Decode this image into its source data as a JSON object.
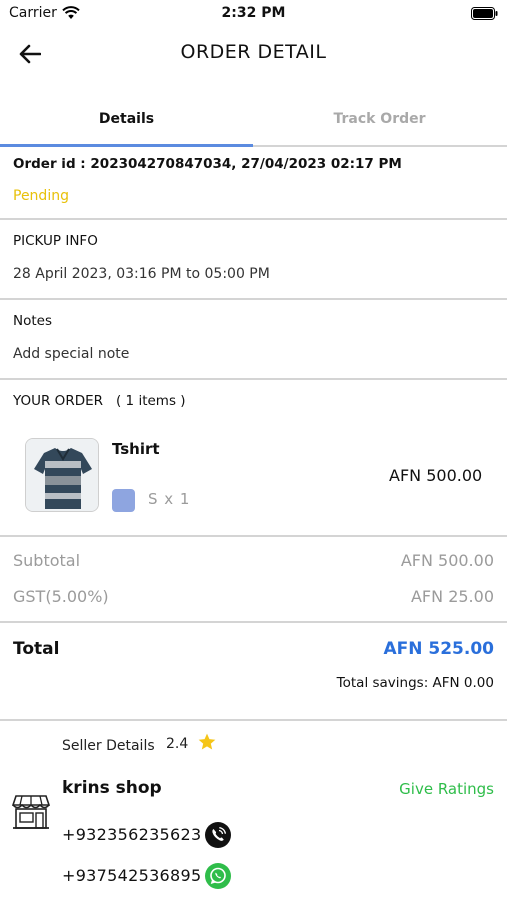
{
  "status_bar": {
    "carrier": "Carrier",
    "time": "2:32 PM",
    "icons": [
      "wifi-icon",
      "battery-icon"
    ]
  },
  "header": {
    "title": "ORDER DETAIL",
    "back_icon": "arrow-left-icon"
  },
  "tabs": [
    {
      "label": "Details",
      "active": true
    },
    {
      "label": "Track Order",
      "active": false
    }
  ],
  "order": {
    "id_line": "Order id : 202304270847034, 27/04/2023 02:17 PM",
    "status": "Pending",
    "status_color": "#e8c10a"
  },
  "pickup": {
    "heading": "PICKUP INFO",
    "time": "28 April 2023, 03:16 PM  to 05:00 PM"
  },
  "notes": {
    "heading": "Notes",
    "value": "Add special note"
  },
  "your_order": {
    "heading": "YOUR ORDER",
    "count": "( 1 items )",
    "items": [
      {
        "name": "Tshirt",
        "variant": "S x 1",
        "price": "AFN 500.00",
        "swatch_color": "#8ea5e0"
      }
    ]
  },
  "summary": {
    "subtotal_label": "Subtotal",
    "subtotal_value": "AFN 500.00",
    "gst_label": "GST(5.00%)",
    "gst_value": "AFN 25.00"
  },
  "total": {
    "label": "Total",
    "value": "AFN 525.00",
    "savings": "Total savings: AFN 0.00",
    "value_color": "#2a6fdb"
  },
  "seller": {
    "label": "Seller Details",
    "rating": "2.4",
    "shop_name": "krins shop",
    "give_ratings": "Give Ratings",
    "phone_call": "+932356235623",
    "phone_whatsapp": "+937542536895"
  },
  "colors": {
    "accent": "#5b8be0",
    "green": "#2fbd4a",
    "star": "#f5c518"
  }
}
